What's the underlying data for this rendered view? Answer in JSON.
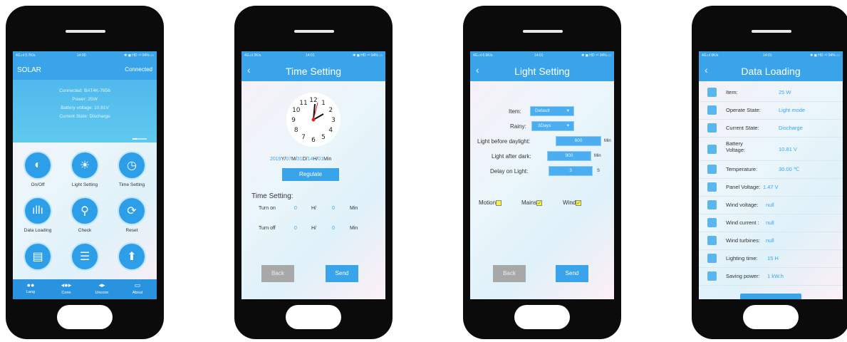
{
  "phones": [
    {
      "status": {
        "carrier": "4G.ııl 5.7K/s",
        "time": "14:00",
        "right": "✱ ◼ HD ⁴ᴳ 94% ▭"
      },
      "app_title": "SOLAR",
      "connection": "Connected",
      "banner_lines": [
        "Connected: BAT4K-7856",
        "Power: 25W",
        "Battery voltage: 10.81V",
        "Current State: Discharge"
      ],
      "tiles": [
        {
          "label": "On/Off",
          "icon": "power-icon"
        },
        {
          "label": "Light Setting",
          "icon": "sun-icon"
        },
        {
          "label": "Time Setting",
          "icon": "clock-icon"
        },
        {
          "label": "Data Loading",
          "icon": "bar-chart-icon"
        },
        {
          "label": "Check",
          "icon": "magnifier-icon"
        },
        {
          "label": "Reset",
          "icon": "reset-icon"
        },
        {
          "label": "",
          "icon": "document-icon"
        },
        {
          "label": "",
          "icon": "list-icon"
        },
        {
          "label": "",
          "icon": "upload-icon"
        }
      ],
      "tabs": [
        {
          "label": "Lang",
          "icon": "chat-icon"
        },
        {
          "label": "Conn",
          "icon": "link-icon"
        },
        {
          "label": "Unconn",
          "icon": "unlink-icon"
        },
        {
          "label": "About",
          "icon": "message-icon"
        }
      ]
    },
    {
      "status": {
        "carrier": "4G.ııl 2K/s",
        "time": "14:01",
        "right": "✱ ◼ HD ⁴ᴳ 94% ▭"
      },
      "title": "Time Setting",
      "back": "‹",
      "clock_numbers": [
        "12",
        "1",
        "2",
        "3",
        "4",
        "5",
        "6",
        "7",
        "8",
        "9",
        "10",
        "11"
      ],
      "date": {
        "year": "2019",
        "y": "Y/",
        "month": "07",
        "m": "M/",
        "day": "31",
        "d": "D/",
        "hour": "14",
        "h": "H/",
        "min": "01",
        "mn": "Min"
      },
      "regulate": "Regulate",
      "section": "Time Setting:",
      "turn_on": {
        "label": "Turn on",
        "h": "0",
        "hu": "H/",
        "m": "0",
        "mu": "Min"
      },
      "turn_off": {
        "label": "Turn off",
        "h": "0",
        "hu": "H/",
        "m": "0",
        "mu": "Min"
      },
      "back_btn": "Back",
      "send_btn": "Send"
    },
    {
      "status": {
        "carrier": "4G.ııl 6.9K/s",
        "time": "14:01",
        "right": "✱ ◼ HD ⁴ᴳ 94% ▭"
      },
      "title": "Light Setting",
      "back": "‹",
      "item_label": "Item:",
      "item_value": "Default",
      "rainy_label": "Rainy:",
      "rainy_value": "3Days",
      "before_label": "Light before daylight:",
      "before_value": "600",
      "before_unit": "Min",
      "after_label": "Light after dark:",
      "after_value": "900",
      "after_unit": "Min",
      "delay_label": "Delay on Light:",
      "delay_value": "3",
      "delay_unit": "S",
      "motion": "Motion",
      "mains": "Mains",
      "wind": "Wind",
      "back_btn": "Back",
      "send_btn": "Send"
    },
    {
      "status": {
        "carrier": "4G.ııl 9K/s",
        "time": "14:01",
        "right": "✱ ◼ HD ⁴ᴳ 94% ▭"
      },
      "title": "Data Loading",
      "back": "‹",
      "rows": [
        {
          "key": "Item:",
          "value": "25 W"
        },
        {
          "key": "Operate State:",
          "value": "Light mode"
        },
        {
          "key": "Current State:",
          "value": "Discharge"
        },
        {
          "key": "Battery Voltage:",
          "value": "10.81  V"
        },
        {
          "key": "Temperature:",
          "value": "30.00  ℃"
        },
        {
          "key": "Panel Voltage:",
          "value": "1.47  V"
        },
        {
          "key": "Wind voltage:",
          "value": "null"
        },
        {
          "key": "Wind current :",
          "value": "null"
        },
        {
          "key": "Wind turbines:",
          "value": "null"
        },
        {
          "key": "Lighting time:",
          "value": "15  H"
        },
        {
          "key": "Saving power:",
          "value": "1  kW.h"
        }
      ]
    }
  ]
}
